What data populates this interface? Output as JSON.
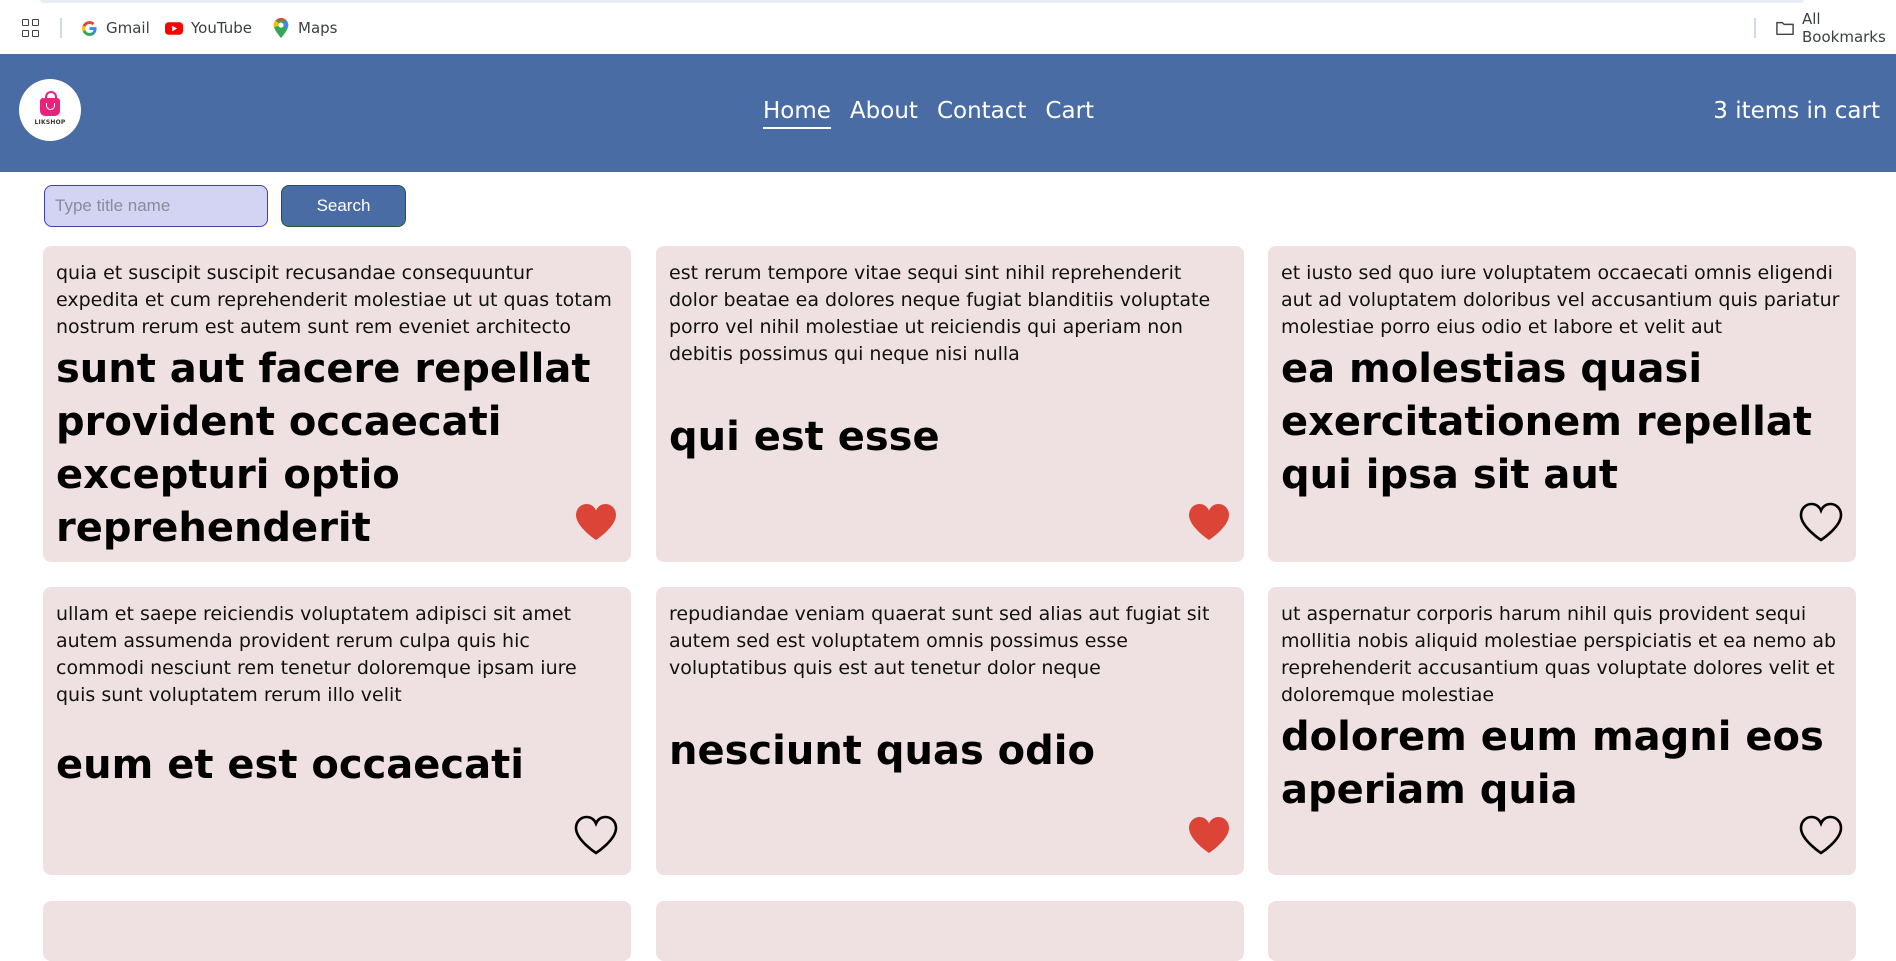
{
  "bookmarks": {
    "items": [
      {
        "label": "Gmail",
        "icon": "google-icon"
      },
      {
        "label": "YouTube",
        "icon": "youtube-icon"
      },
      {
        "label": "Maps",
        "icon": "maps-icon"
      }
    ],
    "all_bookmarks": "All Bookmarks"
  },
  "header": {
    "brand": "LIKSHOP",
    "nav": [
      "Home",
      "About",
      "Contact",
      "Cart"
    ],
    "active_nav": "Home",
    "cart_status": "3 items in cart",
    "background": "#496ca4"
  },
  "search": {
    "placeholder": "Type title name",
    "button": "Search"
  },
  "cards": [
    {
      "body": "quia et suscipit suscipit recusandae consequuntur expedita et cum reprehenderit molestiae ut ut quas totam nostrum rerum est autem sunt rem eveniet architecto",
      "title": "sunt aut facere repellat provident occaecati excepturi optio reprehenderit",
      "favorite": true
    },
    {
      "body": "est rerum tempore vitae sequi sint nihil reprehenderit dolor beatae ea dolores neque fugiat blanditiis voluptate porro vel nihil molestiae ut reiciendis qui aperiam non debitis possimus qui neque nisi nulla",
      "title": "qui est esse",
      "favorite": true
    },
    {
      "body": "et iusto sed quo iure voluptatem occaecati omnis eligendi aut ad voluptatem doloribus vel accusantium quis pariatur molestiae porro eius odio et labore et velit aut",
      "title": "ea molestias quasi exercitationem repellat qui ipsa sit aut",
      "favorite": false
    },
    {
      "body": "ullam et saepe reiciendis voluptatem adipisci sit amet autem assumenda provident rerum culpa quis hic commodi nesciunt rem tenetur doloremque ipsam iure quis sunt voluptatem rerum illo velit",
      "title": "eum et est occaecati",
      "favorite": false
    },
    {
      "body": "repudiandae veniam quaerat sunt sed alias aut fugiat sit autem sed est voluptatem omnis possimus esse voluptatibus quis est aut tenetur dolor neque",
      "title": "nesciunt quas odio",
      "favorite": true
    },
    {
      "body": "ut aspernatur corporis harum nihil quis provident sequi mollitia nobis aliquid molestiae perspiciatis et ea nemo ab reprehenderit accusantium quas voluptate dolores velit et doloremque molestiae",
      "title": "dolorem eum magni eos aperiam quia",
      "favorite": false
    }
  ],
  "colors": {
    "heart_filled": "#db4437",
    "card_background": "#efe1e2"
  }
}
